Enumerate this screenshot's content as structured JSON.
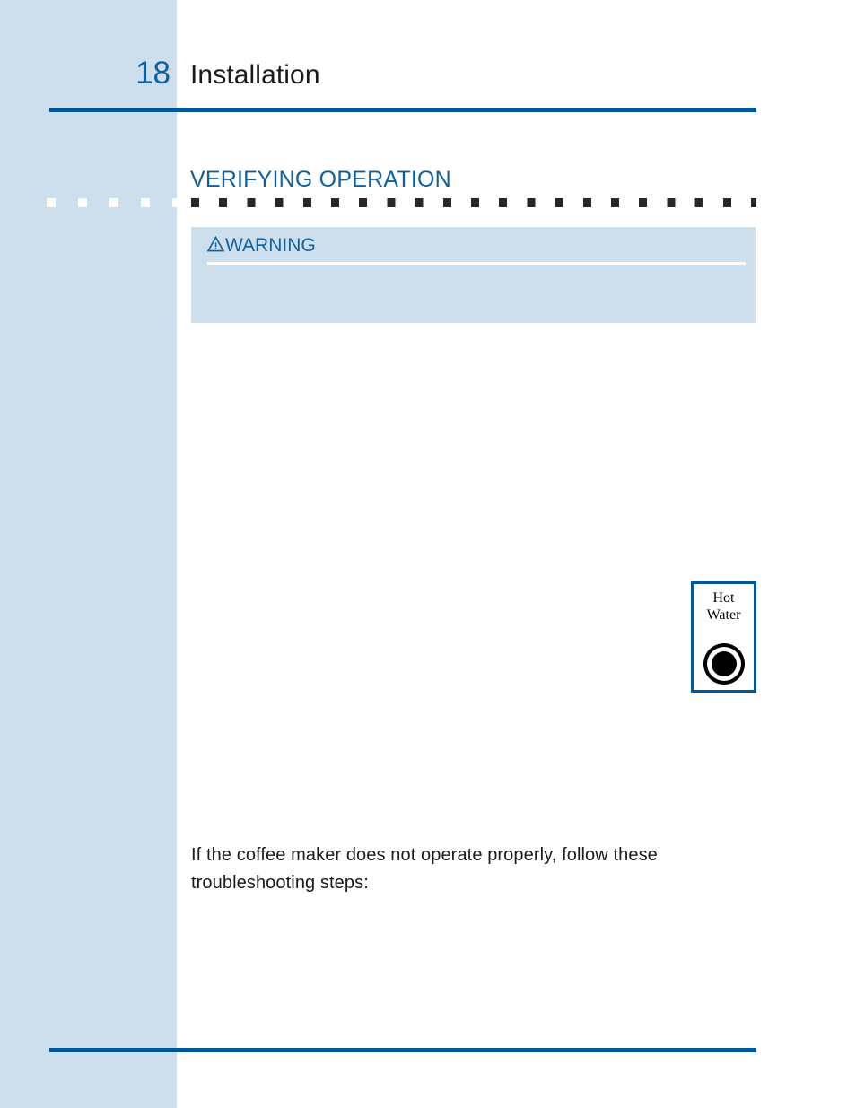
{
  "page": {
    "number": "18",
    "chapter_title": "Installation",
    "accent_color": "#005799",
    "heading_color": "#10609f",
    "band_color": "#cddfed",
    "text_color": "#1a1a1a"
  },
  "section": {
    "heading": "VERIFYING OPERATION"
  },
  "warning": {
    "icon_name": "warning-triangle-icon",
    "icon_glyph": "⚠",
    "label": "WARNING",
    "body": ""
  },
  "figure": {
    "name": "hot-water-button",
    "label_line1": "Hot",
    "label_line2": "Water",
    "button_icon_name": "round-push-button-icon"
  },
  "body": {
    "paragraph": "If the coffee maker does not operate properly, follow these troubleshooting steps:"
  }
}
